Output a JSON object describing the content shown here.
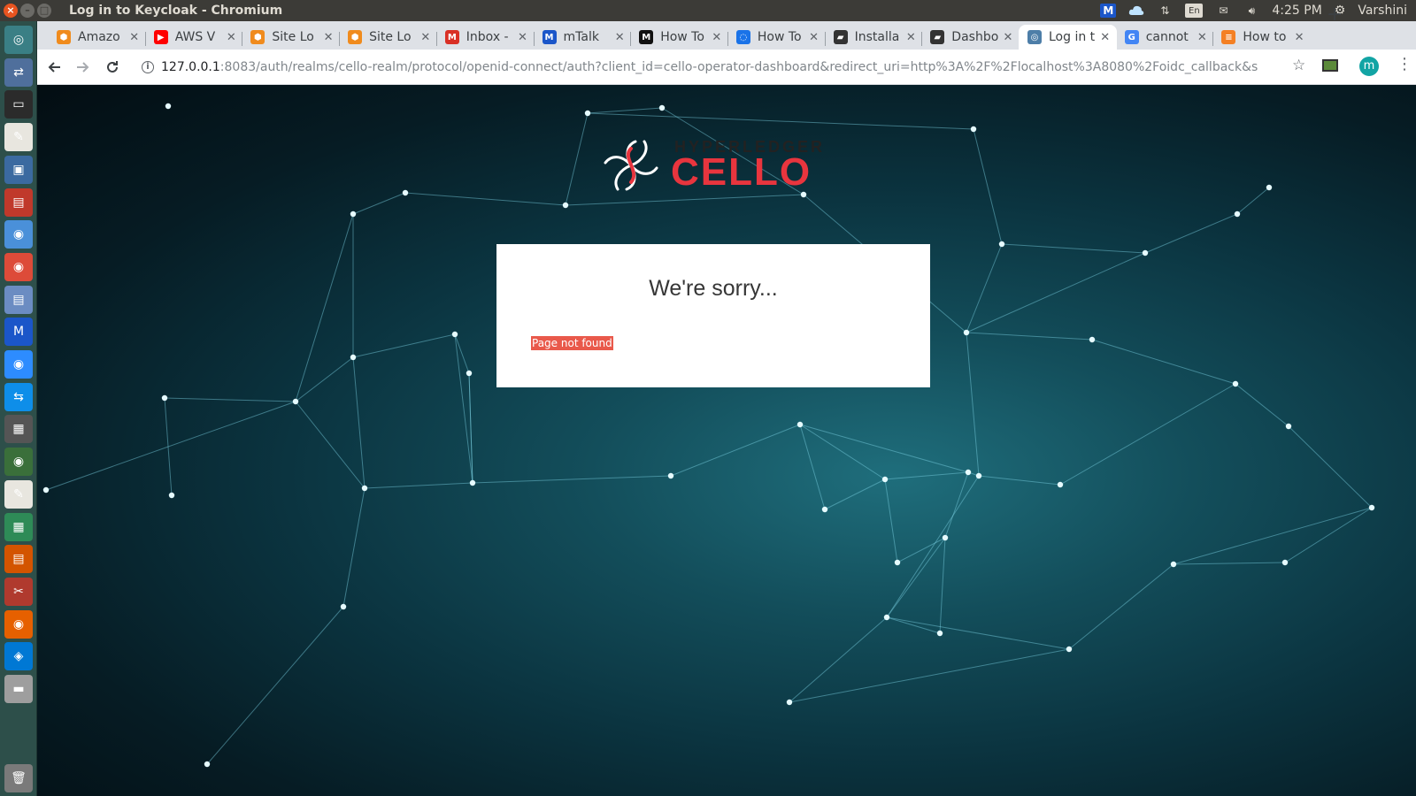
{
  "window": {
    "title": "Log in to Keycloak - Chromium",
    "controls": [
      "×",
      "–",
      "□"
    ]
  },
  "system_tray": {
    "keyboard_layout": "En",
    "clock": "4:25 PM",
    "user": "Varshini",
    "icons": [
      "mtalk-tray-icon",
      "cloud-icon",
      "network-arrows-icon",
      "mail-icon",
      "volume-icon",
      "power-gear-icon"
    ]
  },
  "launcher": {
    "items": [
      "dash-icon",
      "network-tool-icon",
      "terminal-icon",
      "text-editor-icon",
      "screenshot-icon",
      "files-icon",
      "chromium-icon",
      "chrome-icon",
      "document-viewer-icon",
      "mtalk-icon",
      "zoom-icon",
      "teamviewer-icon",
      "video-editor-icon",
      "disk-icon",
      "gedit-icon",
      "spreadsheet-icon",
      "presentation-icon",
      "settings-tools-icon",
      "firefox-icon",
      "vscode-icon",
      "drive-icon",
      "trash-icon"
    ]
  },
  "tabs": [
    {
      "label": "Amazo",
      "icon": "aws-icon",
      "color": "#f08b1d"
    },
    {
      "label": "AWS V",
      "icon": "youtube-icon",
      "color": "#ff0000"
    },
    {
      "label": "Site Lo",
      "icon": "aws-icon",
      "color": "#f08b1d"
    },
    {
      "label": "Site Lo",
      "icon": "aws-icon",
      "color": "#f08b1d"
    },
    {
      "label": "Inbox -",
      "icon": "gmail-icon",
      "color": "#d93025"
    },
    {
      "label": "mTalk",
      "icon": "mtalk-icon",
      "color": "#1b56c9"
    },
    {
      "label": "How To",
      "icon": "medium-icon",
      "color": "#111111"
    },
    {
      "label": "How To",
      "icon": "loading-spinner-icon",
      "color": "#1a73e8"
    },
    {
      "label": "Installa",
      "icon": "document-icon",
      "color": "#333333"
    },
    {
      "label": "Dashbo",
      "icon": "document-icon",
      "color": "#333333"
    },
    {
      "label": "Log in t",
      "icon": "keycloak-icon",
      "color": "#4d7ea8",
      "active": true
    },
    {
      "label": "cannot",
      "icon": "google-icon",
      "color": "#4285f4"
    },
    {
      "label": "How to",
      "icon": "stackoverflow-icon",
      "color": "#f48024"
    }
  ],
  "toolbar": {
    "url_host": "127.0.0.1",
    "url_rest": ":8083/auth/realms/cello-realm/protocol/openid-connect/auth?client_id=cello-operator-dashboard&redirect_uri=http%3A%2F%2Flocalhost%3A8080%2Foidc_callback&scope=openid+em...",
    "profile_initial": "m"
  },
  "logo": {
    "small_text": "HYPERLEDGER",
    "big_text": "CELLO",
    "accent": "#e8353e"
  },
  "error_card": {
    "title": "We're sorry...",
    "message": "Page not found",
    "message_color": "#e9594b"
  }
}
